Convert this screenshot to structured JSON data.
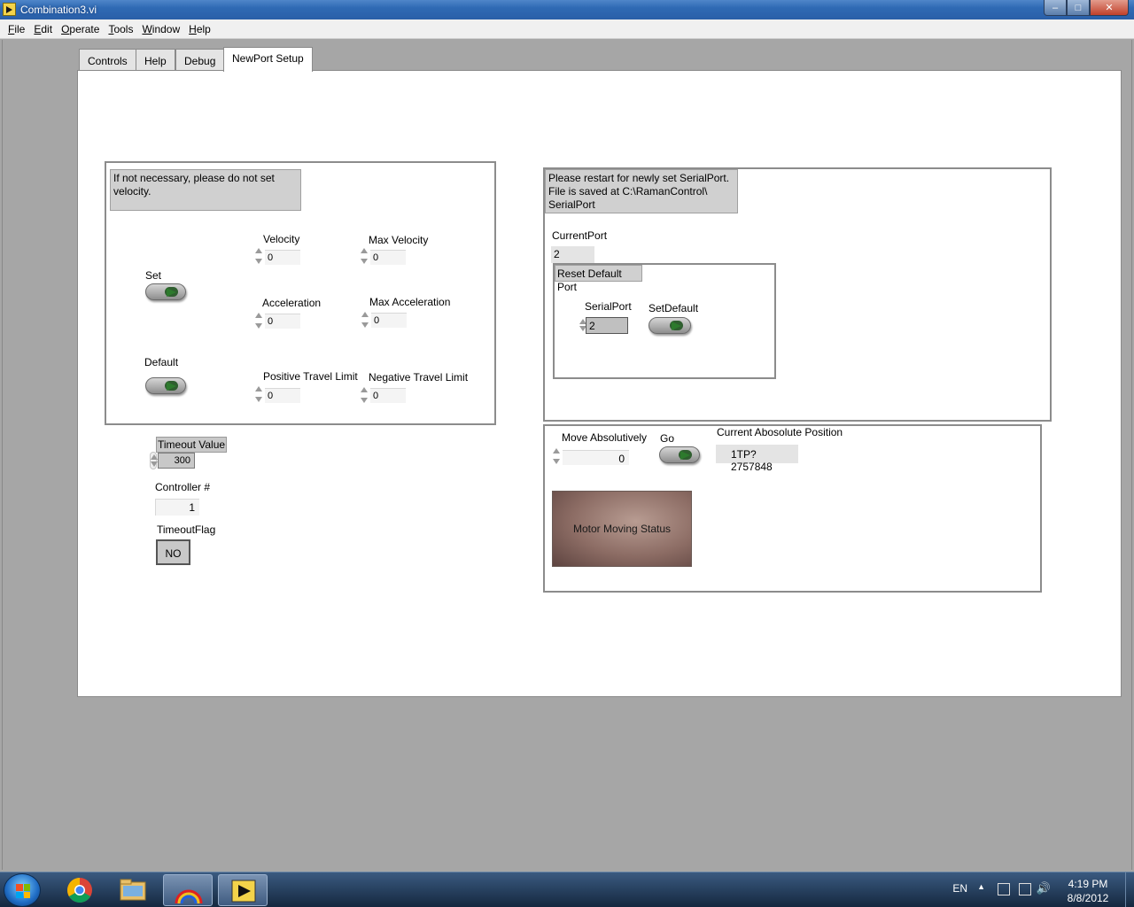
{
  "window": {
    "title": "Combination3.vi"
  },
  "menu": [
    {
      "label": "File",
      "u": "F",
      "rest": "ile"
    },
    {
      "label": "Edit",
      "u": "E",
      "rest": "dit"
    },
    {
      "label": "Operate",
      "u": "O",
      "rest": "perate"
    },
    {
      "label": "Tools",
      "u": "T",
      "rest": "ools"
    },
    {
      "label": "Window",
      "u": "W",
      "rest": "indow"
    },
    {
      "label": "Help",
      "u": "H",
      "rest": "elp"
    }
  ],
  "tabs": [
    "Controls",
    "Help",
    "Debug",
    "NewPort Setup"
  ],
  "active_tab": "NewPort Setup",
  "velocity_panel": {
    "note": "If not necessary, please do not set velocity.",
    "set_label": "Set",
    "default_label": "Default",
    "velocity_label": "Velocity",
    "velocity_value": "0",
    "max_velocity_label": "Max Velocity",
    "max_velocity_value": "0",
    "acceleration_label": "Acceleration",
    "acceleration_value": "0",
    "max_acceleration_label": "Max Acceleration",
    "max_acceleration_value": "0",
    "pos_travel_label": "Positive Travel Limit",
    "pos_travel_value": "0",
    "neg_travel_label": "Negative Travel Limit",
    "neg_travel_value": "0"
  },
  "misc": {
    "timeout_label": "Timeout Value",
    "timeout_value": "300",
    "controller_label": "Controller #",
    "controller_value": "1",
    "timeout_flag_label": "TimeoutFlag",
    "timeout_flag_value": "NO"
  },
  "serial_panel": {
    "note_line1": "Please restart for newly set SerialPort.",
    "note_line2": "File is saved at C:\\RamanControl\\",
    "note_line3": "SerialPort",
    "current_port_label": "CurrentPort",
    "current_port_value": "2",
    "reset_label": "Reset Default Port",
    "serial_port_label": "SerialPort",
    "serial_port_value": "2",
    "set_default_label": "SetDefault"
  },
  "move_panel": {
    "move_label": "Move Absolutively",
    "move_value": "0",
    "go_label": "Go",
    "position_label": "Current Abosolute Position",
    "position_value": "1TP? 2757848",
    "status_label": "Motor Moving Status"
  },
  "taskbar": {
    "lang": "EN",
    "time": "4:19 PM",
    "date": "8/8/2012"
  }
}
